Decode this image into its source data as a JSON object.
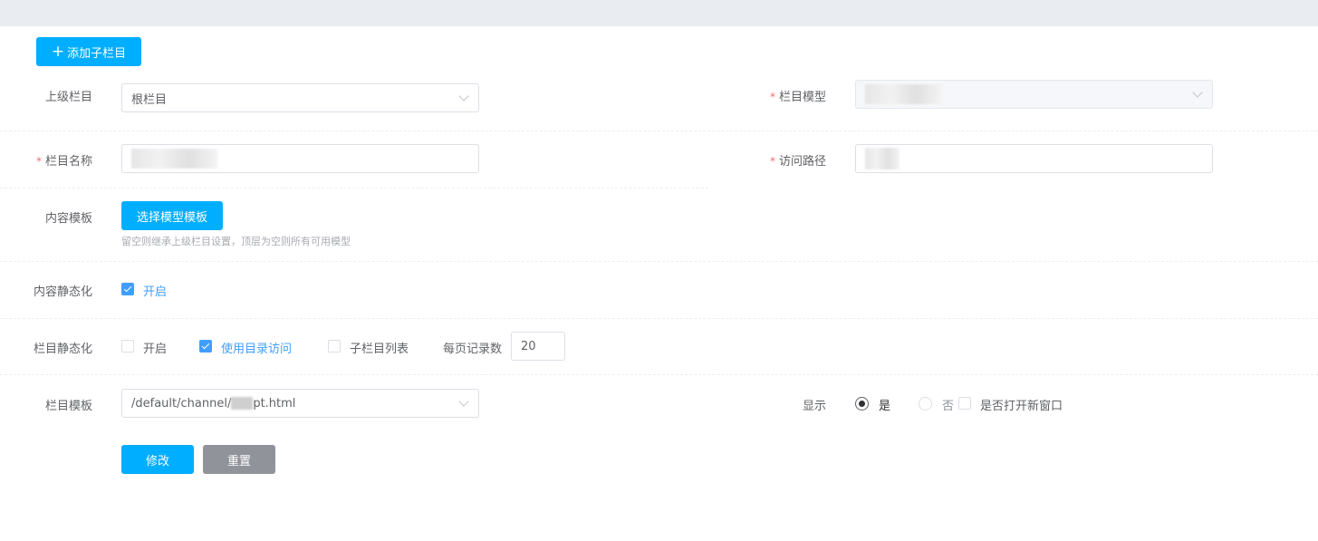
{
  "toolbar": {
    "add_child_label": "添加子栏目"
  },
  "form": {
    "parent": {
      "label": "上级栏目",
      "value": "根栏目"
    },
    "model": {
      "label": "栏目模型",
      "value": ""
    },
    "name": {
      "label": "栏目名称",
      "value": ""
    },
    "path": {
      "label": "访问路径",
      "value": ""
    },
    "content_template": {
      "label": "内容模板",
      "button": "选择模型模板",
      "hint": "留空则继承上级栏目设置，顶层为空则所有可用模型"
    },
    "content_static": {
      "label": "内容静态化",
      "option": "开启",
      "checked": true
    },
    "channel_static": {
      "label": "栏目静态化",
      "options": [
        {
          "label": "开启",
          "checked": false
        },
        {
          "label": "使用目录访问",
          "checked": true
        },
        {
          "label": "子栏目列表",
          "checked": false
        }
      ],
      "page_size_label": "每页记录数",
      "page_size": "20"
    },
    "channel_template": {
      "label": "栏目模板",
      "value_prefix": "/default/channel/",
      "value_suffix": "pt.html"
    },
    "display": {
      "label": "显示",
      "options": [
        "是",
        "否"
      ],
      "selected": "是",
      "new_window_label": "是否打开新窗口",
      "new_window": false
    }
  },
  "actions": {
    "submit": "修改",
    "reset": "重置"
  },
  "colors": {
    "primary": "#00aeff",
    "checkbox": "#409eff",
    "reset": "#909399",
    "required": "#f56c6c"
  }
}
